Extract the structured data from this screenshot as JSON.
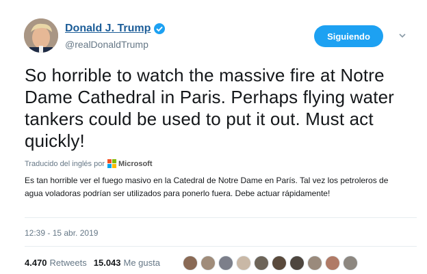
{
  "author": {
    "display_name": "Donald J. Trump",
    "handle": "@realDonaldTrump",
    "verified": true
  },
  "follow_button": {
    "label": "Siguiendo"
  },
  "tweet": {
    "text": "So horrible to watch the massive fire at Notre Dame Cathedral in Paris. Perhaps flying water tankers could be used to put it out. Must act quickly!"
  },
  "translation": {
    "translated_by": "Traducido del inglés por",
    "provider": "Microsoft",
    "text": "Es tan horrible ver el fuego masivo en la Catedral de Notre Dame en París. Tal vez los petroleros de agua voladoras podrían ser utilizados para ponerlo fuera. Debe actuar rápidamente!"
  },
  "timestamp": "12:39 - 15 abr. 2019",
  "stats": {
    "retweets_count": "4.470",
    "retweets_label": "Retweets",
    "likes_count": "15.043",
    "likes_label": "Me gusta"
  },
  "colors": {
    "accent": "#1da1f2",
    "name_link": "#1c5d98",
    "muted": "#657786"
  },
  "icons": {
    "verified": "verified-badge-icon",
    "caret": "chevron-down-icon",
    "provider_logo": "microsoft-logo-icon"
  },
  "likers": [
    {
      "color": "#8a6a55"
    },
    {
      "color": "#a08c7a"
    },
    {
      "color": "#7c7f8a"
    },
    {
      "color": "#c9b8a6"
    },
    {
      "color": "#6d6458"
    },
    {
      "color": "#5a4a3c"
    },
    {
      "color": "#4e463f"
    },
    {
      "color": "#9a8a7c"
    },
    {
      "color": "#b07a66"
    },
    {
      "color": "#8d8780"
    }
  ]
}
